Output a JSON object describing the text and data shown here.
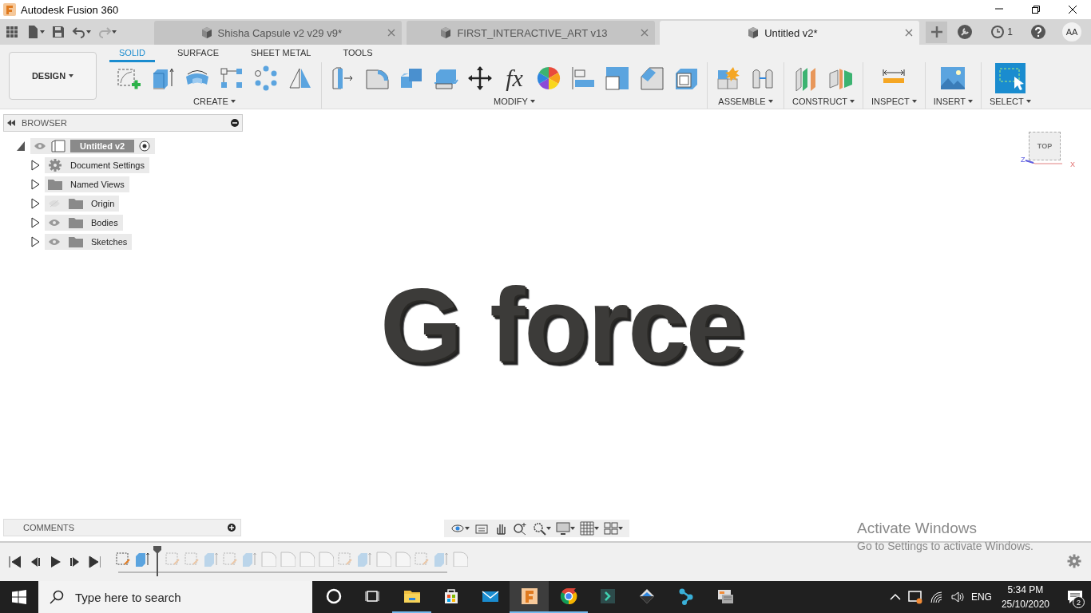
{
  "title_bar": {
    "title": "Autodesk Fusion 360"
  },
  "tabs": [
    {
      "label": "Shisha Capsule v2 v29 v9*",
      "selected": false
    },
    {
      "label": "FIRST_INTERACTIVE_ART v13",
      "selected": false
    },
    {
      "label": "Untitled v2*",
      "selected": true
    }
  ],
  "job_status": {
    "count": "1"
  },
  "user": {
    "initials": "AA"
  },
  "workspace": {
    "label": "DESIGN"
  },
  "toolbar_tabs": [
    {
      "label": "SOLID",
      "selected": true
    },
    {
      "label": "SURFACE",
      "selected": false
    },
    {
      "label": "SHEET METAL",
      "selected": false
    },
    {
      "label": "TOOLS",
      "selected": false
    }
  ],
  "tool_groups": [
    {
      "label": "CREATE",
      "tools": [
        {
          "kind": "sketch"
        },
        {
          "kind": "extrude"
        },
        {
          "kind": "revolve"
        },
        {
          "kind": "rect-pattern"
        },
        {
          "kind": "circular-pattern"
        },
        {
          "kind": "mirror"
        }
      ]
    },
    {
      "label": "MODIFY",
      "tools": [
        {
          "kind": "press-pull"
        },
        {
          "kind": "fillet"
        },
        {
          "kind": "combine"
        },
        {
          "kind": "offset-face"
        },
        {
          "kind": "move"
        },
        {
          "kind": "text",
          "label": "fx"
        },
        {
          "kind": "appearance"
        },
        {
          "kind": "align"
        },
        {
          "kind": "scale"
        },
        {
          "kind": "chamfer"
        },
        {
          "kind": "shell"
        }
      ]
    },
    {
      "label": "ASSEMBLE",
      "tools": [
        {
          "kind": "new-component"
        },
        {
          "kind": "joint"
        }
      ]
    },
    {
      "label": "CONSTRUCT",
      "tools": [
        {
          "kind": "offset-plane"
        },
        {
          "kind": "midplane"
        }
      ]
    },
    {
      "label": "INSPECT",
      "tools": [
        {
          "kind": "measure"
        }
      ]
    },
    {
      "label": "INSERT",
      "tools": [
        {
          "kind": "image"
        }
      ]
    },
    {
      "label": "SELECT",
      "tools": [
        {
          "kind": "select"
        }
      ]
    }
  ],
  "browser": {
    "title": "BROWSER",
    "root": {
      "label": "Untitled v2",
      "expanded": true,
      "children": [
        {
          "label": "Document Settings",
          "kind": "settings",
          "expanded": false
        },
        {
          "label": "Named Views",
          "kind": "folder",
          "expanded": false
        },
        {
          "label": "Origin",
          "kind": "folder",
          "expanded": false,
          "visible": false
        },
        {
          "label": "Bodies",
          "kind": "folder",
          "expanded": false,
          "visible": true
        },
        {
          "label": "Sketches",
          "kind": "folder",
          "expanded": false,
          "visible": true
        }
      ]
    }
  },
  "viewport": {
    "model_text": "G force",
    "view_cube": {
      "face": "TOP",
      "axis_z": "Z",
      "axis_x": "X"
    }
  },
  "comments": {
    "title": "COMMENTS"
  },
  "timeline": {
    "level": 0.1,
    "features": [
      {
        "kind": "sketch",
        "rolled_back": false
      },
      {
        "kind": "body",
        "rolled_back": false
      },
      {
        "kind": "sketch",
        "rolled_back": true
      },
      {
        "kind": "sketch",
        "rolled_back": true
      },
      {
        "kind": "body",
        "rolled_back": true
      },
      {
        "kind": "sketch",
        "rolled_back": true
      },
      {
        "kind": "body",
        "rolled_back": true
      },
      {
        "kind": "fillet",
        "rolled_back": true
      },
      {
        "kind": "fillet",
        "rolled_back": true
      },
      {
        "kind": "fillet",
        "rolled_back": true
      },
      {
        "kind": "fillet",
        "rolled_back": true
      },
      {
        "kind": "sketch",
        "rolled_back": true
      },
      {
        "kind": "body",
        "rolled_back": true
      },
      {
        "kind": "fillet",
        "rolled_back": true
      },
      {
        "kind": "fillet",
        "rolled_back": true
      },
      {
        "kind": "sketch",
        "rolled_back": true
      },
      {
        "kind": "body",
        "rolled_back": true
      },
      {
        "kind": "fillet",
        "rolled_back": true
      }
    ]
  },
  "activation_notice": {
    "title": "Activate Windows",
    "message": "Go to Settings to activate Windows."
  },
  "taskbar": {
    "search_placeholder": "Type here to search",
    "apps": [
      {
        "kind": "ring",
        "selected": false,
        "running": false
      },
      {
        "kind": "task-view",
        "selected": false,
        "running": false
      },
      {
        "kind": "folder",
        "selected": false,
        "running": true
      },
      {
        "kind": "bag",
        "selected": false,
        "running": false
      },
      {
        "kind": "mail",
        "selected": false,
        "running": false
      },
      {
        "kind": "cad",
        "selected": true,
        "running": true
      },
      {
        "kind": "globe",
        "selected": false,
        "running": true
      },
      {
        "kind": "teal-tile",
        "selected": false,
        "running": false
      },
      {
        "kind": "diamond",
        "selected": false,
        "running": false
      },
      {
        "kind": "nodes",
        "selected": false,
        "running": false
      },
      {
        "kind": "cards",
        "selected": false,
        "running": false
      }
    ],
    "language": "ENG",
    "time": "5:34 PM",
    "date": "25/10/2020",
    "notifications": "2"
  }
}
